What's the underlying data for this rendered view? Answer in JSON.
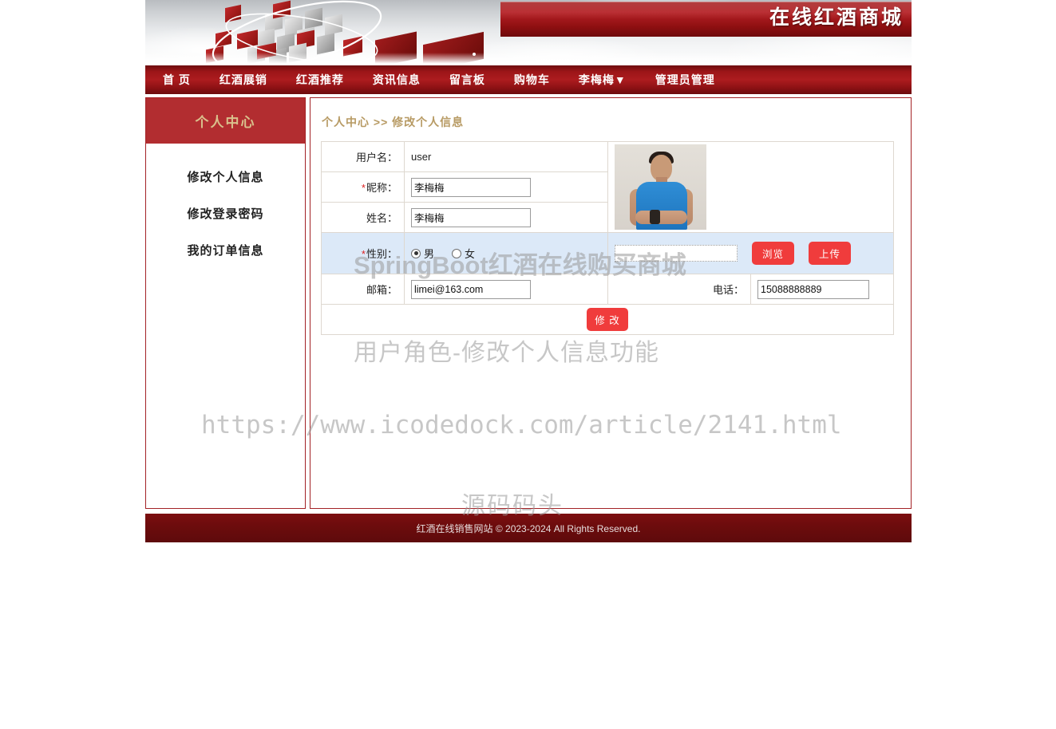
{
  "header": {
    "site_title": "在线红酒商城"
  },
  "nav": {
    "items": [
      {
        "label": "首 页",
        "name": "nav-home"
      },
      {
        "label": "红酒展销",
        "name": "nav-wine-expo"
      },
      {
        "label": "红酒推荐",
        "name": "nav-wine-recommend"
      },
      {
        "label": "资讯信息",
        "name": "nav-news"
      },
      {
        "label": "留言板",
        "name": "nav-message-board"
      },
      {
        "label": "购物车",
        "name": "nav-cart"
      },
      {
        "label": "李梅梅▼",
        "name": "nav-user-menu"
      },
      {
        "label": "管理员管理",
        "name": "nav-admin"
      }
    ]
  },
  "sidebar": {
    "title": "个人中心",
    "items": [
      {
        "label": "修改个人信息",
        "name": "sidebar-item-edit-profile"
      },
      {
        "label": "修改登录密码",
        "name": "sidebar-item-change-password"
      },
      {
        "label": "我的订单信息",
        "name": "sidebar-item-my-orders"
      }
    ]
  },
  "main": {
    "breadcrumb": "个人中心 >> 修改个人信息",
    "form": {
      "username_label": "用户名：",
      "username_value": "user",
      "nickname_label": "昵称：",
      "nickname_required": "*",
      "nickname_value": "李梅梅",
      "realname_label": "姓名：",
      "realname_value": "李梅梅",
      "gender_label": "性别：",
      "gender_required": "*",
      "gender_options": [
        {
          "label": "男",
          "selected": true
        },
        {
          "label": "女",
          "selected": false
        }
      ],
      "email_label": "邮箱：",
      "email_value": "limei@163.com",
      "phone_label": "电话：",
      "phone_value": "15088888889",
      "file_value": "",
      "browse_label": "浏览",
      "upload_label": "上传",
      "submit_label": "修 改",
      "photo_alt": "用户头像"
    }
  },
  "footer": {
    "text": "红酒在线销售网站  © 2023-2024 All Rights Reserved."
  },
  "watermarks": {
    "line1": "SpringBoot红酒在线购买商城",
    "line2": "用户角色-修改个人信息功能",
    "line3": "https://www.icodedock.com/article/2141.html",
    "line4": "源码码头"
  },
  "colors": {
    "brand_red": "#a32226",
    "nav_red": "#ad1c1f",
    "sidebar_title": "#d9c08c",
    "breadcrumb": "#b79a63",
    "button_red": "#f03c3c",
    "upload_bg": "#dce9f8",
    "footer_bg": "#6d0c0d"
  }
}
